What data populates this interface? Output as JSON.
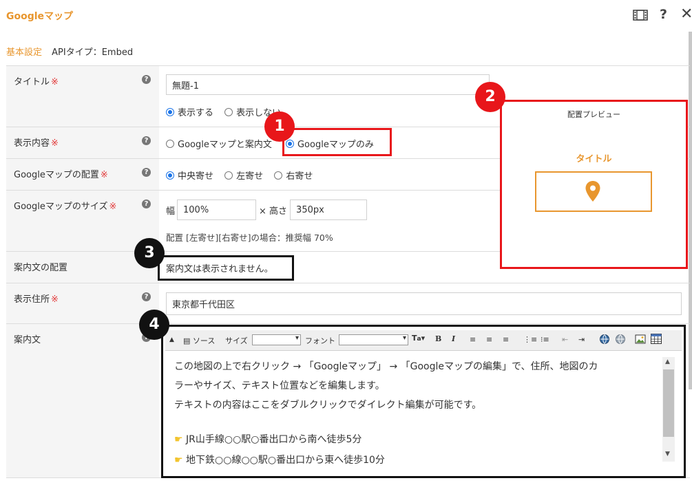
{
  "window": {
    "title": "Googleマップ",
    "icons": [
      "film-icon",
      "help-icon",
      "close-icon"
    ]
  },
  "subnav": {
    "basic_label": "基本設定",
    "api_label": "APIタイプ：Embed"
  },
  "form": {
    "title": {
      "label": "タイトル",
      "required": "※",
      "value": "無題-1",
      "options": [
        "表示する",
        "表示しない"
      ],
      "selected": 0
    },
    "content": {
      "label": "表示内容",
      "required": "※",
      "options": [
        "Googleマップと案内文",
        "Googleマップのみ"
      ],
      "selected": 1
    },
    "placement": {
      "label": "Googleマップの配置",
      "required": "※",
      "options": [
        "中央寄せ",
        "左寄せ",
        "右寄せ"
      ],
      "selected": 0
    },
    "size": {
      "label": "Googleマップのサイズ",
      "required": "※",
      "width_label": "幅",
      "width_value": "100%",
      "height_label": "× 高さ",
      "height_value": "350px",
      "note": "配置 [左寄せ][右寄せ]の場合：推奨幅 70%"
    },
    "guide_placement": {
      "label": "案内文の配置",
      "value": "案内文は表示されません。"
    },
    "address": {
      "label": "表示住所",
      "required": "※",
      "value": "東京都千代田区"
    },
    "guide_text": {
      "label": "案内文",
      "toolbar": {
        "source_label": "ソース",
        "size_label": "サイズ",
        "font_label": "フォント"
      },
      "lines": [
        "この地図の上で右クリック → 「Googleマップ」 → 「Googleマップの編集」で、住所、地図のカ",
        "ラーやサイズ、テキスト位置などを編集します。",
        "テキストの内容はここをダブルクリックでダイレクト編集が可能です。",
        "JR山手線○○駅○番出口から南へ徒歩5分",
        "地下鉄○○線○○駅○番出口から東へ徒歩10分"
      ]
    }
  },
  "preview": {
    "title": "配置プレビュー",
    "heading": "タイトル",
    "icon": "map-pin-icon"
  },
  "badges": [
    "1",
    "2",
    "3",
    "4"
  ],
  "colors": {
    "accent": "#e8962e",
    "highlight_red": "#e8161a",
    "required": "#e23b3b",
    "radio": "#1a73e8"
  }
}
